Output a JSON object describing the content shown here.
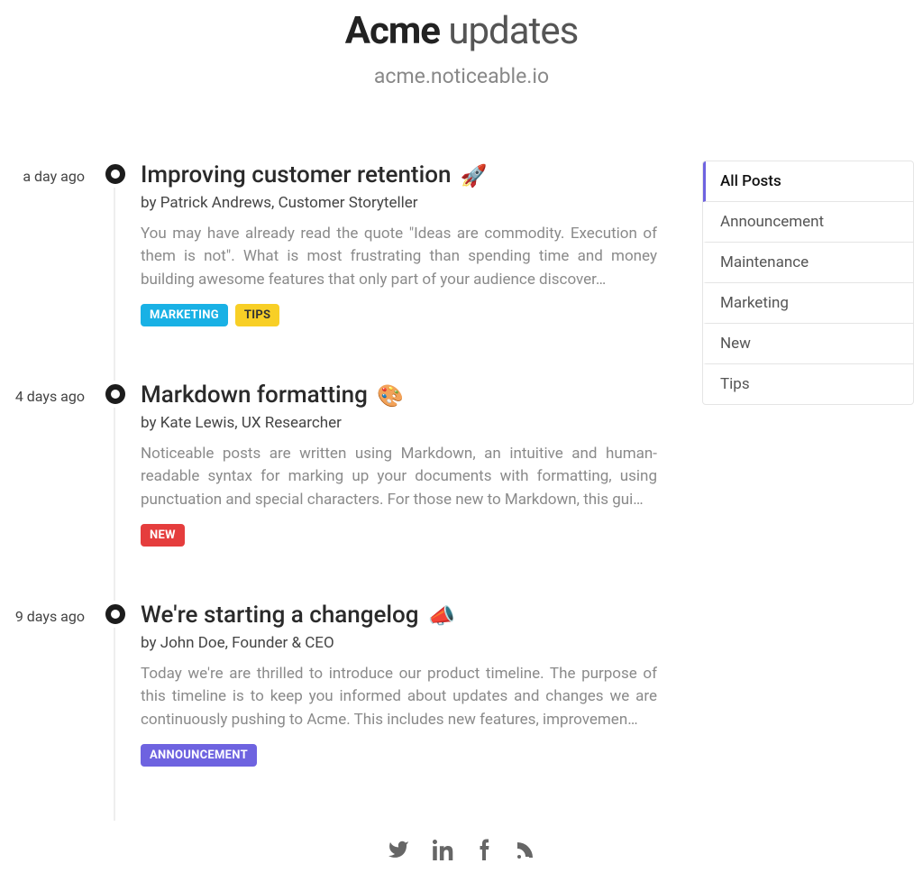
{
  "header": {
    "brand": "Acme",
    "suffix": "updates",
    "subtitle": "acme.noticeable.io"
  },
  "posts": [
    {
      "time": "a day ago",
      "title": "Improving customer retention",
      "emoji": "🚀",
      "byline": "by Patrick Andrews, Customer Storyteller",
      "excerpt": "You may have already read the quote \"Ideas are commodity. Execution of them is not\". What is most frustrating than spending time and money building awesome features that only part of your audience discover…",
      "tags": [
        {
          "label": "MARKETING",
          "color": "#19b1e5"
        },
        {
          "label": "TIPS",
          "color": "#f8cf26",
          "text": "#333"
        }
      ]
    },
    {
      "time": "4 days ago",
      "title": "Markdown formatting",
      "emoji": "🎨",
      "byline": "by Kate Lewis, UX Researcher",
      "excerpt": "Noticeable posts are written using Markdown, an intuitive and human-readable syntax for marking up your documents with formatting, using punctuation and special characters. For those new to Markdown, this gui…",
      "tags": [
        {
          "label": "NEW",
          "color": "#e53d3d"
        }
      ]
    },
    {
      "time": "9 days ago",
      "title": "We're starting a changelog",
      "emoji": "📣",
      "byline": "by John Doe, Founder & CEO",
      "excerpt": "Today we're are thrilled to introduce our product timeline. The purpose of this timeline is to keep you informed about updates and changes we are continuously pushing to Acme. This includes new features, improvemen…",
      "tags": [
        {
          "label": "ANNOUNCEMENT",
          "color": "#6e63e0"
        }
      ]
    }
  ],
  "categories": [
    {
      "label": "All Posts",
      "active": true
    },
    {
      "label": "Announcement",
      "active": false
    },
    {
      "label": "Maintenance",
      "active": false
    },
    {
      "label": "Marketing",
      "active": false
    },
    {
      "label": "New",
      "active": false
    },
    {
      "label": "Tips",
      "active": false
    }
  ],
  "social": {
    "twitter": "twitter-icon",
    "linkedin": "linkedin-icon",
    "facebook": "facebook-icon",
    "rss": "rss-icon"
  }
}
